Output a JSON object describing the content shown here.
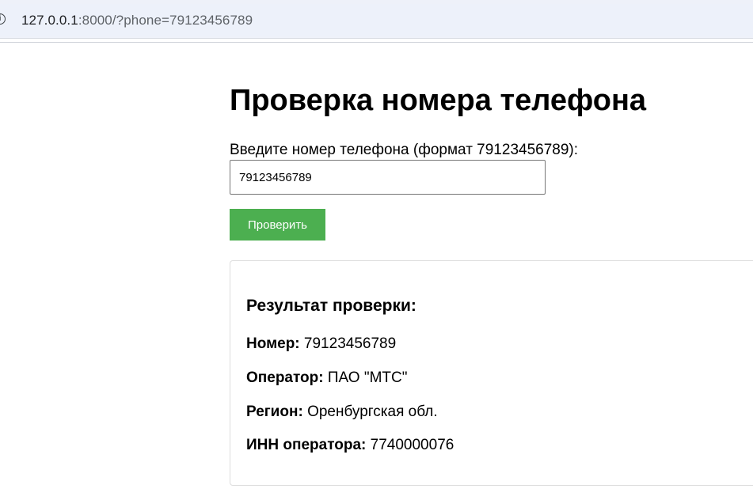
{
  "browser": {
    "url_host": "127.0.0.1",
    "url_rest": ":8000/?phone=79123456789",
    "info_icon": "info-icon"
  },
  "page": {
    "title": "Проверка номера телефона",
    "phone_label": "Введите номер телефона (формат 79123456789):",
    "phone_value": "79123456789",
    "check_button_label": "Проверить",
    "button_color": "#4caf50"
  },
  "result": {
    "title": "Результат проверки:",
    "number_label": "Номер:",
    "number_value": "79123456789",
    "operator_label": "Оператор:",
    "operator_value": "ПАО \"МТС\"",
    "region_label": "Регион:",
    "region_value": "Оренбургская обл.",
    "inn_label": "ИНН оператора:",
    "inn_value": "7740000076"
  }
}
